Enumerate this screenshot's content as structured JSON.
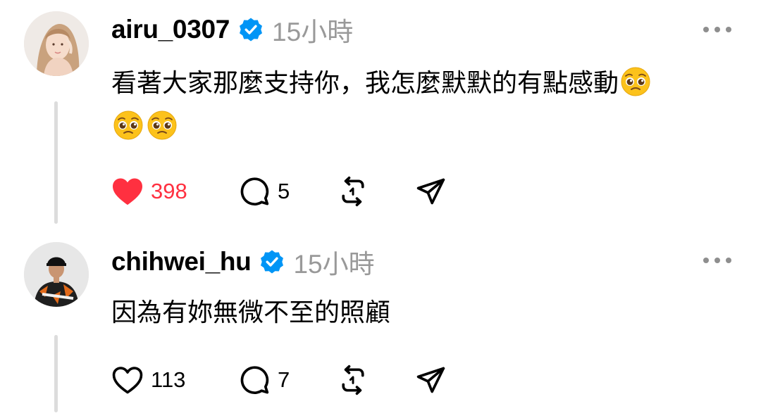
{
  "posts": [
    {
      "username": "airu_0307",
      "verified_icon": "verified-badge-icon",
      "timestamp": "15小時",
      "text": "看著大家那麼支持你，我怎麼默默的有點感動",
      "emoji_count": 3,
      "emoji": "pleading-face-icon",
      "liked": true,
      "like_count": "398",
      "comment_count": "5"
    },
    {
      "username": "chihwei_hu",
      "verified_icon": "verified-badge-icon",
      "timestamp": "15小時",
      "text": "因為有妳無微不至的照顧",
      "liked": false,
      "like_count": "113",
      "comment_count": "7"
    }
  ],
  "colors": {
    "like_active": "#ff3040",
    "verified": "#0095f6",
    "muted": "#999999",
    "thread_line": "#dcdcdc"
  }
}
